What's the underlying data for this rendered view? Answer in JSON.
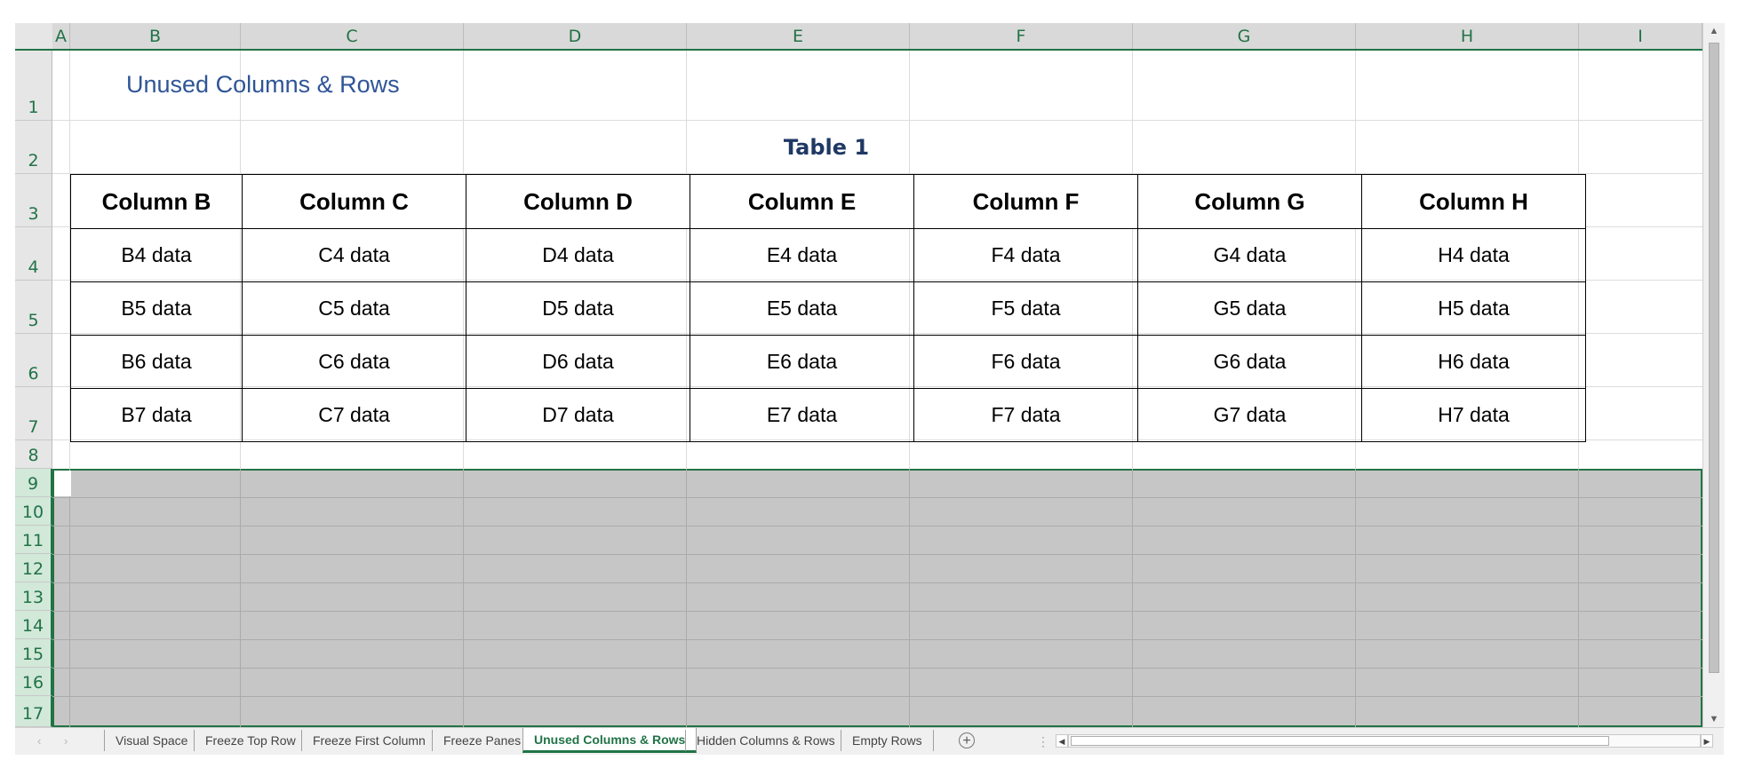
{
  "sheet": {
    "title": "Unused Columns & Rows",
    "table_caption": "Table 1",
    "columns": [
      "A",
      "B",
      "C",
      "D",
      "E",
      "F",
      "G",
      "H",
      "I"
    ],
    "rows": [
      "1",
      "2",
      "3",
      "4",
      "5",
      "6",
      "7",
      "8",
      "9",
      "10",
      "11",
      "12",
      "13",
      "14",
      "15",
      "16",
      "17"
    ],
    "table_headers": [
      "Column B",
      "Column C",
      "Column D",
      "Column E",
      "Column F",
      "Column G",
      "Column H"
    ],
    "table_rows": [
      [
        "B4 data",
        "C4 data",
        "D4 data",
        "E4 data",
        "F4 data",
        "G4 data",
        "H4 data"
      ],
      [
        "B5 data",
        "C5 data",
        "D5 data",
        "E5 data",
        "F5 data",
        "G5 data",
        "H5 data"
      ],
      [
        "B6 data",
        "C6 data",
        "D6 data",
        "E6 data",
        "F6 data",
        "G6 data",
        "H6 data"
      ],
      [
        "B7 data",
        "C7 data",
        "D7 data",
        "E7 data",
        "F7 data",
        "G7 data",
        "H7 data"
      ]
    ]
  },
  "tabs": {
    "items": [
      "Visual Space",
      "Freeze Top Row",
      "Freeze First Column",
      "Freeze Panes",
      "Unused Columns & Rows",
      "Hidden Columns & Rows",
      "Empty Rows"
    ],
    "active": "Unused Columns & Rows",
    "add_icon": "plus-circle-icon"
  },
  "colors": {
    "accent": "#217346",
    "title": "#2f5597",
    "caption": "#1f3864",
    "selected_fill": "#c6c6c6"
  }
}
